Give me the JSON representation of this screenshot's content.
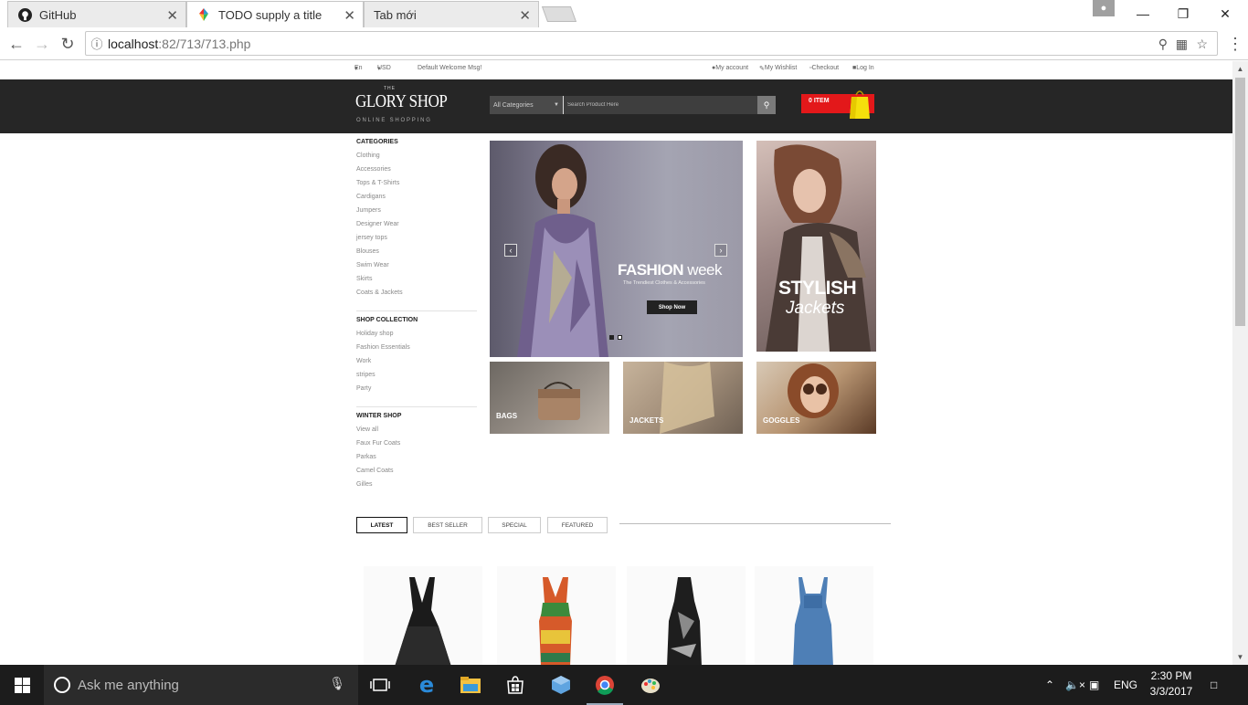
{
  "browser": {
    "tabs": [
      {
        "title": "GitHub"
      },
      {
        "title": "TODO supply a title"
      },
      {
        "title": "Tab mới"
      }
    ],
    "url_host": "localhost",
    "url_path": ":82/713/713.php"
  },
  "site": {
    "topbar": {
      "lang": "En",
      "currency": "USD",
      "welcome": "Default Welcome Msg!",
      "my_account": "My account",
      "wishlist": "My Wishlist",
      "checkout": "Checkout",
      "login": "Log In"
    },
    "logo": {
      "the": "THE",
      "name": "GLORY SHOP",
      "tagline": "ONLINE SHOPPING"
    },
    "search": {
      "category": "All Categories",
      "placeholder": "Search Product Here"
    },
    "cart": {
      "label": "0 ITEM"
    },
    "sidebar": {
      "categories_title": "CATEGORIES",
      "categories": [
        "Clothing",
        "Accessories",
        "Tops & T-Shirts",
        "Cardigans",
        "Jumpers",
        "Designer Wear",
        "jersey tops",
        "Blouses",
        "Swim Wear",
        "Skirts",
        "Coats & Jackets"
      ],
      "collection_title": "SHOP COLLECTION",
      "collection": [
        "Holiday shop",
        "Fashion Essentials",
        "Work",
        "stripes",
        "Party"
      ],
      "winter_title": "WINTER SHOP",
      "winter": [
        "View all",
        "Faux Fur Coats",
        "Parkas",
        "Camel Coats",
        "Gilles"
      ]
    },
    "slider": {
      "title_bold": "FASHION",
      "title_thin": "week",
      "subtitle": "The Trendiest Clothes & Accessories",
      "cta": "Shop Now"
    },
    "side_banner": {
      "line1": "STYLISH",
      "line2": "Jackets"
    },
    "tiles": [
      "BAGS",
      "JACKETS",
      "GOGGLES"
    ],
    "product_tabs": [
      "LATEST",
      "BEST SELLER",
      "SPECIAL",
      "FEATURED"
    ]
  },
  "taskbar": {
    "search_placeholder": "Ask me anything",
    "language": "ENG",
    "time": "2:30 PM",
    "date": "3/3/2017"
  }
}
